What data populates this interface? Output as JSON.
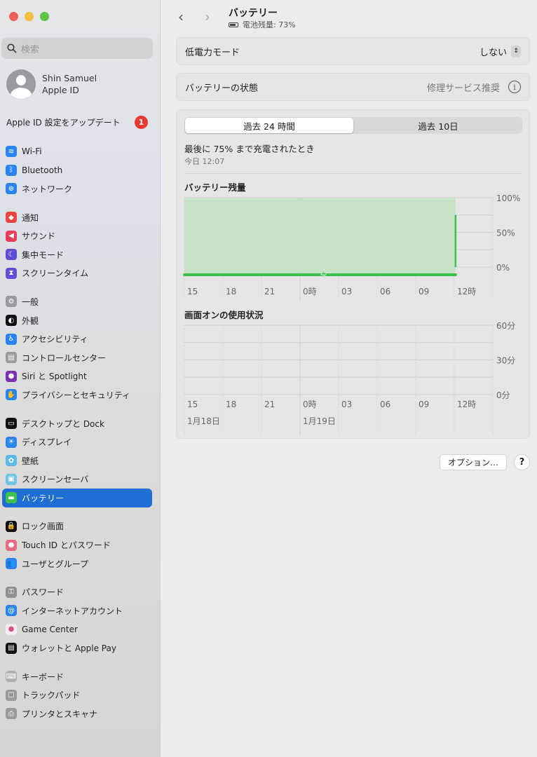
{
  "window": {
    "buttons": [
      "close",
      "minimize",
      "zoom"
    ]
  },
  "sidebar": {
    "search_placeholder": "検索",
    "account": {
      "name": "Shin Samuel",
      "sub": "Apple ID"
    },
    "update": {
      "label": "Apple ID 設定をアップデート",
      "badge": "1"
    },
    "groups": [
      [
        {
          "label": "Wi-Fi",
          "icon": "wifi-icon",
          "color": "#2a84f0",
          "glyph": "≋"
        },
        {
          "label": "Bluetooth",
          "icon": "bluetooth-icon",
          "color": "#2a84f0",
          "glyph": "ᛒ"
        },
        {
          "label": "ネットワーク",
          "icon": "globe-icon",
          "color": "#2a84f0",
          "glyph": "⊕"
        }
      ],
      [
        {
          "label": "通知",
          "icon": "bell-icon",
          "color": "#e8453c",
          "glyph": "◆"
        },
        {
          "label": "サウンド",
          "icon": "speaker-icon",
          "color": "#e83c5a",
          "glyph": "◀"
        },
        {
          "label": "集中モード",
          "icon": "moon-icon",
          "color": "#5b4fd6",
          "glyph": "☾"
        },
        {
          "label": "スクリーンタイム",
          "icon": "hourglass-icon",
          "color": "#5b4fd6",
          "glyph": "⧗"
        }
      ],
      [
        {
          "label": "一般",
          "icon": "gear-icon",
          "color": "#9a9a9e",
          "glyph": "⚙"
        },
        {
          "label": "外観",
          "icon": "appearance-icon",
          "color": "#111111",
          "glyph": "◐"
        },
        {
          "label": "アクセシビリティ",
          "icon": "accessibility-icon",
          "color": "#2a84f0",
          "glyph": "♿"
        },
        {
          "label": "コントロールセンター",
          "icon": "control-center-icon",
          "color": "#9a9a9e",
          "glyph": "▤"
        },
        {
          "label": "Siri と Spotlight",
          "icon": "siri-icon",
          "color": "#7a2fb0",
          "glyph": "●"
        },
        {
          "label": "プライバシーとセキュリティ",
          "icon": "hand-icon",
          "color": "#2a84f0",
          "glyph": "✋"
        }
      ],
      [
        {
          "label": "デスクトップと Dock",
          "icon": "dock-icon",
          "color": "#111111",
          "glyph": "▭"
        },
        {
          "label": "ディスプレイ",
          "icon": "display-icon",
          "color": "#2a84f0",
          "glyph": "☀"
        },
        {
          "label": "壁紙",
          "icon": "wallpaper-icon",
          "color": "#5ab8ea",
          "glyph": "✿"
        },
        {
          "label": "スクリーンセーバ",
          "icon": "screensaver-icon",
          "color": "#6cc4e8",
          "glyph": "▣"
        },
        {
          "label": "バッテリー",
          "icon": "battery-icon",
          "color": "#3cc24a",
          "glyph": "▬",
          "selected": true
        }
      ],
      [
        {
          "label": "ロック画面",
          "icon": "lock-icon",
          "color": "#111111",
          "glyph": "🔒"
        },
        {
          "label": "Touch ID とパスワード",
          "icon": "fingerprint-icon",
          "color": "#e86b7e",
          "glyph": "●"
        },
        {
          "label": "ユーザとグループ",
          "icon": "users-icon",
          "color": "#2a84f0",
          "glyph": "👥"
        }
      ],
      [
        {
          "label": "パスワード",
          "icon": "key-icon",
          "color": "#8e8e93",
          "glyph": "⚿"
        },
        {
          "label": "インターネットアカウント",
          "icon": "at-icon",
          "color": "#2a84f0",
          "glyph": "@"
        },
        {
          "label": "Game Center",
          "icon": "game-center-icon",
          "color": "#f0f0f0",
          "glyph": "●"
        },
        {
          "label": "ウォレットと Apple Pay",
          "icon": "wallet-icon",
          "color": "#111111",
          "glyph": "▤"
        }
      ],
      [
        {
          "label": "キーボード",
          "icon": "keyboard-icon",
          "color": "#b0b0b4",
          "glyph": "⌨"
        },
        {
          "label": "トラックパッド",
          "icon": "trackpad-icon",
          "color": "#9a9a9e",
          "glyph": "▢"
        },
        {
          "label": "プリンタとスキャナ",
          "icon": "printer-icon",
          "color": "#9a9a9e",
          "glyph": "⎙"
        }
      ]
    ]
  },
  "header": {
    "title": "バッテリー",
    "subtitle": "電池残量: 73%"
  },
  "low_power": {
    "label": "低電力モード",
    "value": "しない"
  },
  "health": {
    "label": "バッテリーの状態",
    "value": "修理サービス推奨"
  },
  "tabs": [
    {
      "label": "過去 24 時間",
      "active": true
    },
    {
      "label": "過去 10日",
      "active": false
    }
  ],
  "last_charge": {
    "label": "最後に 75% まで充電されたとき",
    "time": "今日 12:07"
  },
  "chart_data": [
    {
      "type": "area",
      "title": "バッテリー残量",
      "x_ticks": [
        "15",
        "18",
        "21",
        "0時",
        "03",
        "06",
        "09",
        "12時"
      ],
      "y_ticks": [
        "100%",
        "50%",
        "0%"
      ],
      "ylim": [
        0,
        100
      ],
      "series": [
        {
          "name": "battery-level",
          "x_hours_from_start": [
            0,
            21.1
          ],
          "values": [
            100,
            100
          ]
        }
      ],
      "charging": {
        "from_hours": 0,
        "to_hours": 21.1
      },
      "current_level": {
        "at_hours": 21.1,
        "value": 75
      },
      "color": "#3cc24a"
    },
    {
      "type": "bar",
      "title": "画面オンの使用状況",
      "x_ticks": [
        "15",
        "18",
        "21",
        "0時",
        "03",
        "06",
        "09",
        "12時"
      ],
      "y_ticks": [
        "60分",
        "30分",
        "0分"
      ],
      "ylim": [
        0,
        60
      ],
      "dates": [
        "1月18日",
        "1月19日"
      ],
      "values": []
    }
  ],
  "footer": {
    "options": "オプション…",
    "help": "?"
  }
}
